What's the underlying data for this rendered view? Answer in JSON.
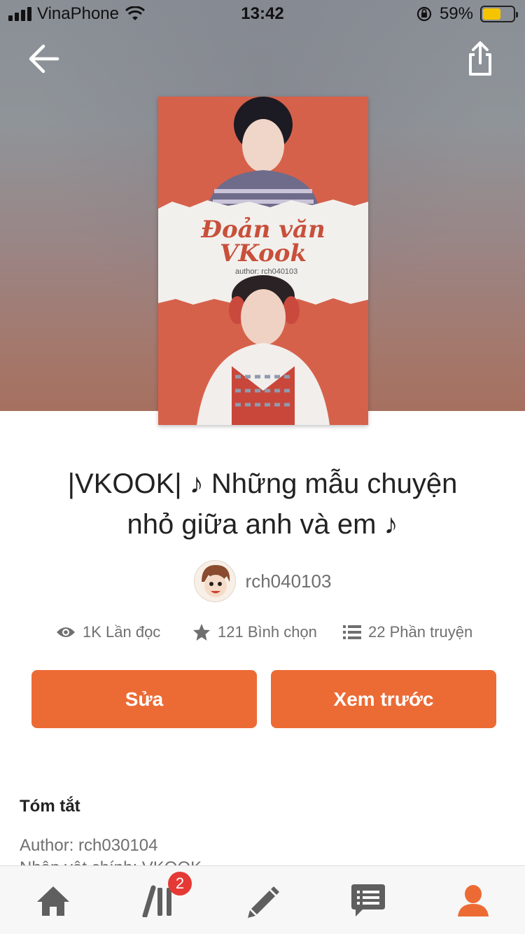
{
  "status_bar": {
    "carrier": "VinaPhone",
    "time": "13:42",
    "battery": "59%",
    "battery_level": 0.59
  },
  "book": {
    "title_line1": "|VKOOK| ♪ Những mẫu chuyện",
    "title_line2": "nhỏ giữa anh và em ♪",
    "cover_title_line1": "Đoản văn",
    "cover_title_line2": "VKook",
    "cover_author": "author: rch040103"
  },
  "author": {
    "name": "rch040103"
  },
  "stats": {
    "reads": "1K Lần đọc",
    "votes": "121 Bình chọn",
    "parts": "22 Phần truyện"
  },
  "actions": {
    "edit_label": "Sửa",
    "preview_label": "Xem trước"
  },
  "summary": {
    "heading": "Tóm tắt",
    "line1": "Author: rch030104",
    "line2": "Nhân vật chính: VKOOK"
  },
  "tabbar": {
    "library_badge": "2"
  },
  "colors": {
    "accent": "#EC6B35",
    "badge": "#E53935"
  }
}
